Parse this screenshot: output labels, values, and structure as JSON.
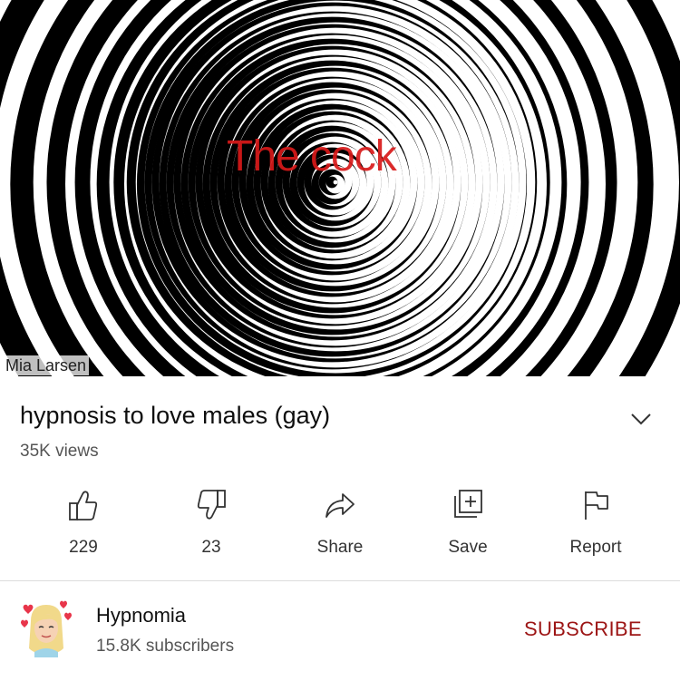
{
  "video": {
    "overlay_caption": "The cock",
    "watermark": "Mia Larsen",
    "title": "hypnosis to love males (gay)",
    "views": "35K views",
    "expand_icon": "chevron-down-icon"
  },
  "actions": [
    {
      "icon": "thumbs-up-icon",
      "label": "229"
    },
    {
      "icon": "thumbs-down-icon",
      "label": "23"
    },
    {
      "icon": "share-icon",
      "label": "Share"
    },
    {
      "icon": "save-playlist-icon",
      "label": "Save"
    },
    {
      "icon": "flag-icon",
      "label": "Report"
    }
  ],
  "channel": {
    "name": "Hypnomia",
    "subscribers": "15.8K subscribers",
    "subscribe_label": "SUBSCRIBE",
    "subscribe_color": "#9c1414"
  },
  "colors": {
    "caption": "#d81a1a",
    "spiral_dark": "#000000",
    "spiral_light": "#ffffff"
  }
}
